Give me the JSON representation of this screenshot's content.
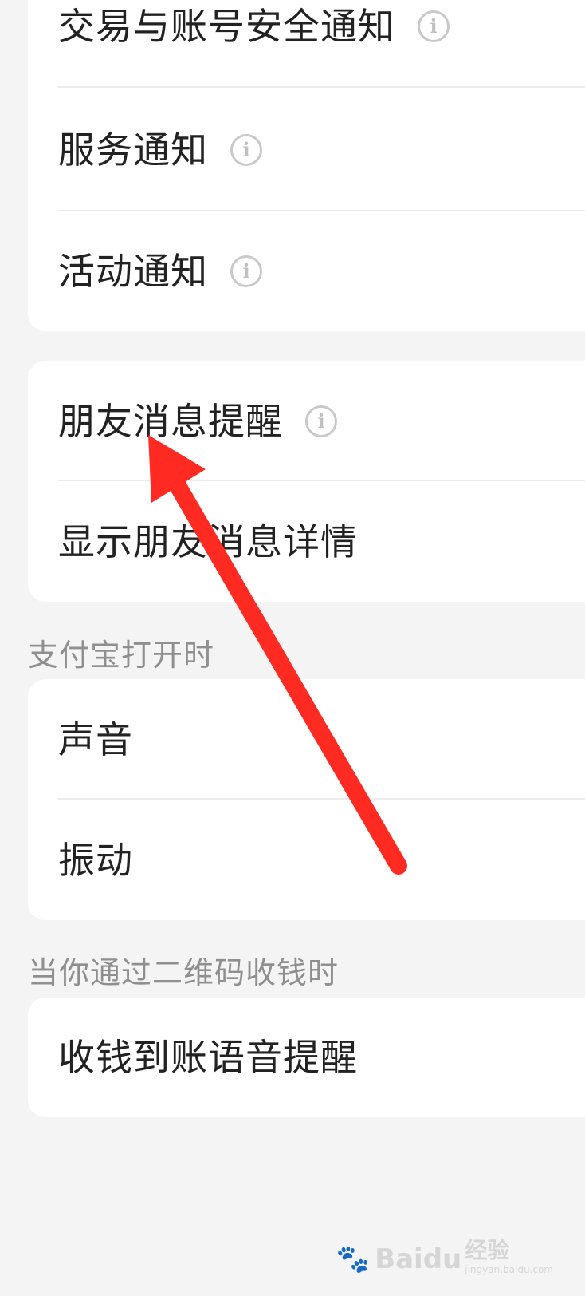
{
  "groups": [
    {
      "rows": [
        {
          "label": "交易与账号安全通知",
          "info": "i"
        },
        {
          "label": "服务通知",
          "info": "i"
        },
        {
          "label": "活动通知",
          "info": "i"
        }
      ]
    },
    {
      "rows": [
        {
          "label": "朋友消息提醒",
          "info": "i"
        },
        {
          "label": "显示朋友消息详情"
        }
      ]
    },
    {
      "section": "支付宝打开时",
      "rows": [
        {
          "label": "声音"
        },
        {
          "label": "振动"
        }
      ]
    },
    {
      "section": "当你通过二维码收钱时",
      "rows": [
        {
          "label": "收钱到账语音提醒"
        }
      ]
    }
  ],
  "annotation": {
    "arrow_color": "#ff2a22"
  },
  "watermark": {
    "brand": "Baidu",
    "sub_cn": "经验",
    "sub_en": "jingyan.baidu.com"
  },
  "colors": {
    "background": "#f4f4f4",
    "card": "#ffffff",
    "text": "#222222",
    "section": "#8f8f8f"
  }
}
